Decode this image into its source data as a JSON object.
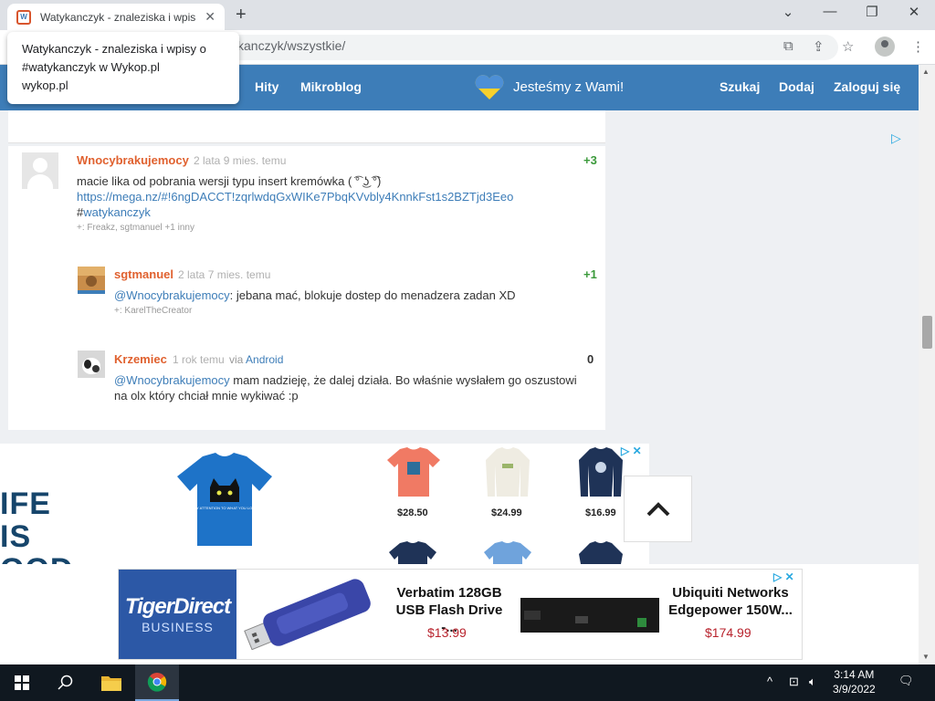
{
  "browser": {
    "tab_title": "Watykanczyk - znaleziska i wpisy",
    "url": "kanczyk/wszystkie/",
    "tooltip_title_1": "Watykanczyk - znaleziska i wpisy o",
    "tooltip_title_2": "#watykanczyk w Wykop.pl",
    "tooltip_domain": "wykop.pl"
  },
  "header": {
    "nav": [
      "Hity",
      "Mikroblog"
    ],
    "support_text": "Jesteśmy z Wami!",
    "right_nav": [
      "Szukaj",
      "Dodaj",
      "Zaloguj się"
    ],
    "heart_colors": {
      "top": "#4d8fd6",
      "bottom": "#f7d02c"
    }
  },
  "comments": [
    {
      "author": "Wnocybrakujemocy",
      "time": "2 lata 9 mies. temu",
      "score": "+3",
      "line1": "macie lika od pobrania wersji typu insert kremówka ( ͡° ͜ʖ ͡°)",
      "link": "https://mega.nz/#!6ngDACCT!zqrlwdqGxWIKe7PbqKVvbly4KnnkFst1s2BZTjd3Eeo",
      "tag_hash": "#",
      "tag": "watykanczyk",
      "plus": "+: Freakz, sgtmanuel +1 inny"
    },
    {
      "author": "sgtmanuel",
      "time": "2 lata 7 mies. temu",
      "score": "+1",
      "mention": "@Wnocybrakujemocy",
      "text": ": jebana mać, blokuje dostep do menadzera zadan XD",
      "plus": "+: KarelTheCreator"
    },
    {
      "author": "Krzemiec",
      "time": "1 rok temu",
      "via_label": "via",
      "via": "Android",
      "score": "0",
      "mention": "@Wnocybrakujemocy",
      "text1": " mam nadzieję, że dalej działa. Bo właśnie wysłałem go oszustowi",
      "text2": "na olx który chciał mnie wykiwać :p"
    }
  ],
  "ad_shirts": {
    "brand_lines": [
      "IFE",
      "IS",
      "OOD"
    ],
    "prices": [
      "$28.50",
      "$24.99",
      "$16.99"
    ],
    "shirt_caption": "PAY ATTENTION TO WHAT YOU LOVE"
  },
  "ad_tiger": {
    "logo_1": "TigerDirect",
    "logo_2": "BUSINESS",
    "products": [
      {
        "name_1": "Verbatim 128GB",
        "name_2": "USB Flash Drive -...",
        "price": "$13.99"
      },
      {
        "name_1": "Ubiquiti Networks",
        "name_2": "Edgepower 150W...",
        "price": "$174.99"
      }
    ]
  },
  "taskbar": {
    "time": "3:14 AM",
    "date": "3/9/2022"
  }
}
